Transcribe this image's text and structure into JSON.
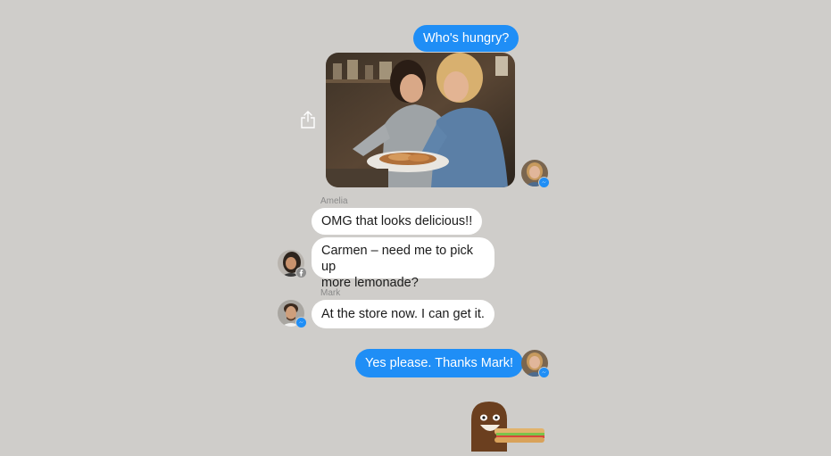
{
  "conversation": {
    "messages": [
      {
        "sender": "me",
        "text": "Who's hungry?"
      },
      {
        "sender": "Amelia",
        "text": "OMG that looks delicious!!"
      },
      {
        "sender": "Amelia",
        "text_line1": "Carmen – need me to pick up",
        "text_line2": "more lemonade?"
      },
      {
        "sender": "Mark",
        "text": "At the store now. I can get it."
      },
      {
        "sender": "me",
        "text": "Yes please. Thanks Mark!"
      }
    ],
    "sender_labels": {
      "amelia": "Amelia",
      "mark": "Mark"
    },
    "photo_description_icon": "photo-attachment",
    "share_icon": "share-icon",
    "sticker_icon": "sandwich-monster-sticker"
  },
  "colors": {
    "background": "#cfcdca",
    "outgoing_bubble": "#1f8ef6",
    "incoming_bubble": "#ffffff"
  }
}
